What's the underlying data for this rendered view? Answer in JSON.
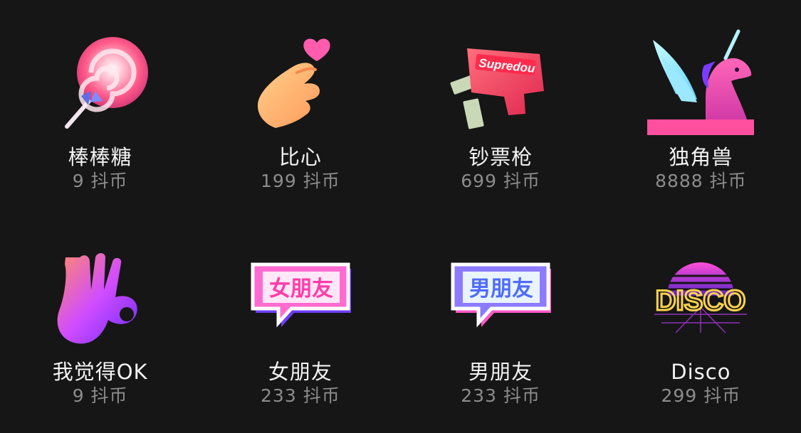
{
  "gifts": [
    {
      "name": "棒棒糖",
      "price": "9 抖币",
      "icon": "lollipop-icon"
    },
    {
      "name": "比心",
      "price": "199 抖币",
      "icon": "finger-heart-icon"
    },
    {
      "name": "钞票枪",
      "price": "699 抖币",
      "icon": "money-gun-icon",
      "icon_text": "Supredou"
    },
    {
      "name": "独角兽",
      "price": "8888 抖币",
      "icon": "unicorn-icon"
    },
    {
      "name": "我觉得OK",
      "price": "9 抖币",
      "icon": "ok-hand-icon"
    },
    {
      "name": "女朋友",
      "price": "233 抖币",
      "icon": "girlfriend-bubble-icon",
      "icon_text": "女朋友"
    },
    {
      "name": "男朋友",
      "price": "233 抖币",
      "icon": "boyfriend-bubble-icon",
      "icon_text": "男朋友"
    },
    {
      "name": "Disco",
      "price": "299 抖币",
      "icon": "disco-sign-icon",
      "icon_text": "DISCO"
    }
  ],
  "colors": {
    "background": "#161616",
    "name_text": "#f2f2f2",
    "price_text": "#8c8c8c",
    "accent_pink": "#ff3d9a",
    "accent_purple": "#8a4dff"
  }
}
